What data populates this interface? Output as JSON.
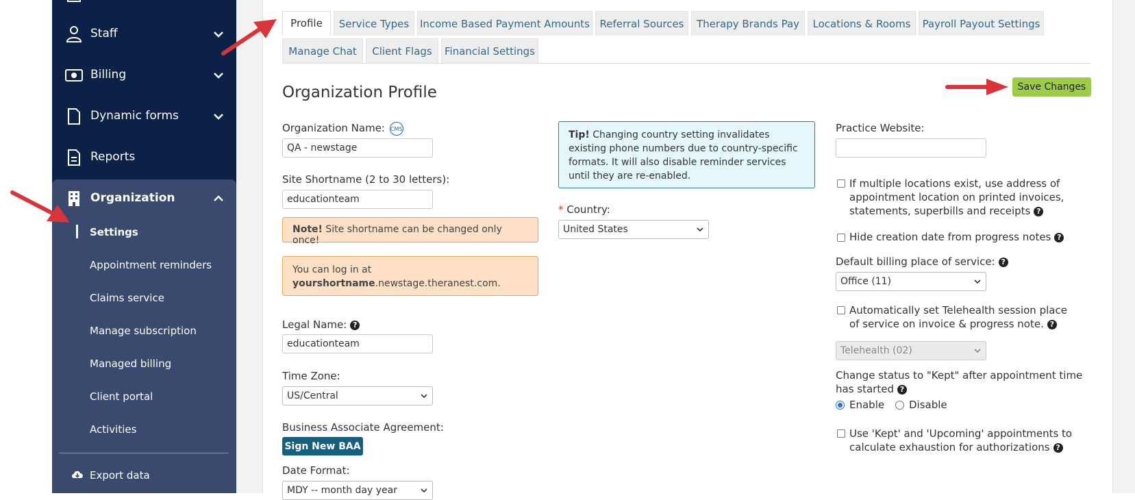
{
  "sidebar": {
    "items": [
      {
        "label": "Staff",
        "icon": "staff-icon"
      },
      {
        "label": "Billing",
        "icon": "billing-icon"
      },
      {
        "label": "Dynamic forms",
        "icon": "dynamic-forms-icon"
      },
      {
        "label": "Reports",
        "icon": "reports-icon"
      },
      {
        "label": "Organization",
        "icon": "organization-icon"
      }
    ],
    "org_subitems": [
      "Settings",
      "Appointment reminders",
      "Claims service",
      "Manage subscription",
      "Managed billing",
      "Client portal",
      "Activities"
    ],
    "export_label": "Export data"
  },
  "tabs": [
    "Profile",
    "Service Types",
    "Income Based Payment Amounts",
    "Referral Sources",
    "Therapy Brands Pay",
    "Locations & Rooms",
    "Payroll Payout Settings",
    "Manage Chat",
    "Client Flags",
    "Financial Settings"
  ],
  "main": {
    "title": "Organization Profile",
    "save_label": "Save Changes",
    "org_name_label": "Organization Name:",
    "cms_badge": "CMS",
    "org_name_value": "QA - newstage",
    "shortname_label": "Site Shortname (2 to 30 letters):",
    "shortname_value": "educationteam",
    "note_bold": "Note!",
    "note_text": " Site shortname can be changed only once!",
    "login_line1": "You can log in at",
    "login_bold": "yourshortname",
    "login_rest": ".newstage.theranest.com.",
    "legal_label": "Legal Name:",
    "legal_value": "educationteam",
    "tz_label": "Time Zone:",
    "tz_value": "US/Central",
    "baa_label": "Business Associate Agreement:",
    "baa_button": "Sign New BAA",
    "date_label": "Date Format:",
    "date_value": "MDY -- month day year",
    "tip_bold": "Tip!",
    "tip_text": " Changing country setting invalidates existing phone numbers due to country-specific formats. It will also disable reminder services until they are re-enabled.",
    "country_required": "*",
    "country_label": "Country:",
    "country_value": "United States",
    "website_label": "Practice Website:",
    "website_value": "",
    "cb_multi_address": "If multiple locations exist, use address of appointment location on printed invoices, statements, superbills and receipts",
    "cb_hide_creation": "Hide creation date from progress notes",
    "billing_pos_label": "Default billing place of service:",
    "billing_pos_value": "Office (11)",
    "cb_telehealth": "Automatically set Telehealth session place of service on invoice & progress note.",
    "telehealth_value": "Telehealth (02)",
    "kept_label": "Change status to \"Kept\" after appointment time has started",
    "enable_label": "Enable",
    "disable_label": "Disable",
    "cb_kept_upcoming": "Use 'Kept' and 'Upcoming' appointments to calculate exhaustion for authorizations",
    "qmark": "?"
  },
  "colors": {
    "sidebar_bg": "#0c2147",
    "org_group_bg": "#3a4a6e",
    "save_button": "#9ccc4a",
    "baa_button": "#155f7d",
    "arrow": "#d9343a"
  }
}
